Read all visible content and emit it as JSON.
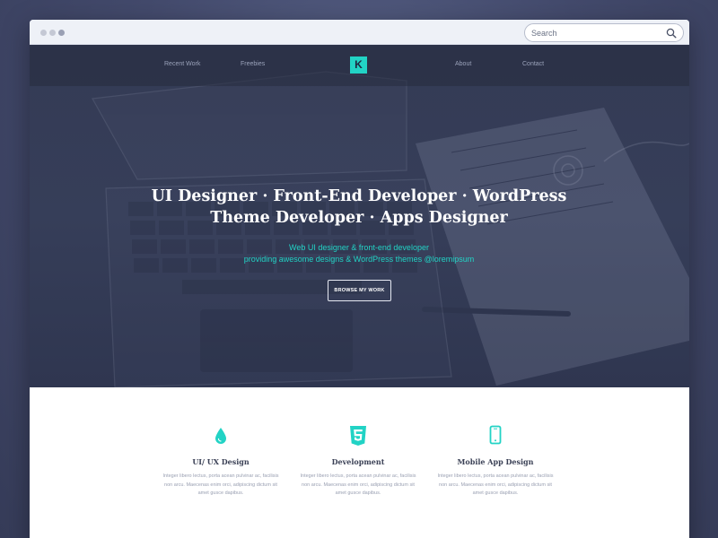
{
  "search": {
    "placeholder": "Search"
  },
  "nav": {
    "items": [
      {
        "label": "Recent Work"
      },
      {
        "label": "Freebies"
      },
      {
        "label": "About"
      },
      {
        "label": "Contact"
      }
    ],
    "logo_letter": "K"
  },
  "hero": {
    "title": "UI Designer · Front-End Developer · WordPress Theme Developer · Apps Designer",
    "subtitle_line1": "Web UI  designer & front-end developer",
    "subtitle_line2": "providing awesome designs & WordPress themes @loremipsum",
    "cta_label": "BROWSE MY WORK"
  },
  "features": [
    {
      "icon": "drop-icon",
      "title": "UI/ UX Design",
      "text_lines": [
        "Integer libero lectus, porta acean pulvinar ac, facilisis",
        "non arcu. Maecenas enim orci, adipiscing dictum sit",
        "amet gusce dapibus."
      ]
    },
    {
      "icon": "html5-icon",
      "title": "Development",
      "text_lines": [
        "Integer libero lectus, porta acean pulvinar ac, facilisis",
        "non arcu. Maecenas enim orci, adipiscing dictum sit",
        "amet gusce dapibus."
      ]
    },
    {
      "icon": "mobile-phone-icon",
      "title": "Mobile App Design",
      "text_lines": [
        "Integer libero lectus, porta acean pulvinar ac, facilisis",
        "non arcu. Maecenas enim orci, adipiscing dictum sit",
        "amet gusce dapibus."
      ]
    }
  ],
  "colors": {
    "accent": "#22d3c5",
    "hero_bg": "#363e59",
    "page_bg": "#434a6c"
  }
}
